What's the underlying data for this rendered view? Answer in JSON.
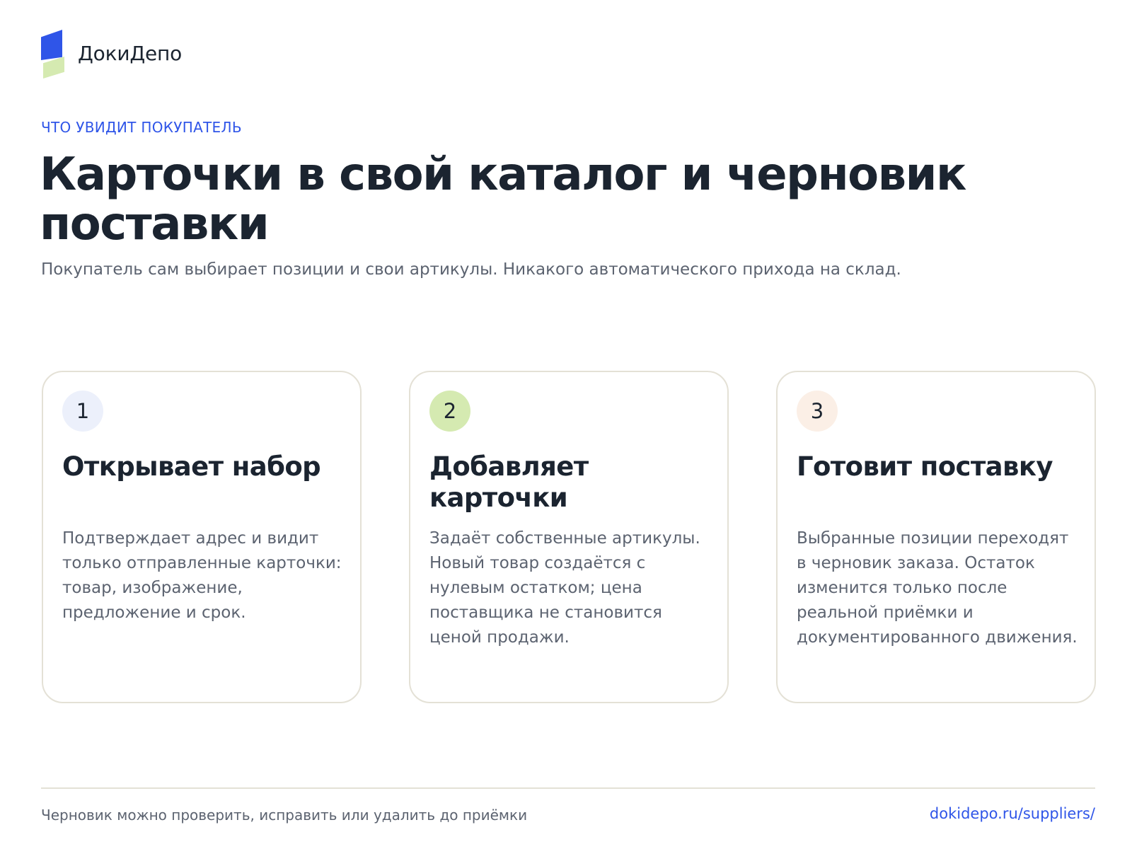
{
  "brand": {
    "name": "ДокиДепо",
    "colors": {
      "accent": "#2f55e8",
      "accent_light": "#d5eab1",
      "text": "#1b2430",
      "muted": "#5c6370",
      "border": "#e4e1d6"
    }
  },
  "header": {
    "eyebrow": "ЧТО УВИДИТ ПОКУПАТЕЛЬ",
    "title": "Карточки в свой каталог и черновик поставки",
    "subtitle": "Покупатель сам выбирает позиции и свои артикулы. Никакого автоматического прихода на склад."
  },
  "steps": [
    {
      "number": "1",
      "badge_color": "#ecf0fb",
      "title": "Открывает набор",
      "text": "Подтверждает адрес и видит только отправленные карточки: товар, изображение, предложение и срок."
    },
    {
      "number": "2",
      "badge_color": "#d5eab1",
      "title": "Добавляет карточки",
      "text": "Задаёт собственные артикулы. Новый товар создаётся с нулевым остатком; цена поставщика не становится ценой продажи."
    },
    {
      "number": "3",
      "badge_color": "#fbefe6",
      "title": "Готовит поставку",
      "text": "Выбранные позиции переходят в черновик заказа. Остаток изменится только после реальной приёмки и документированного движения."
    }
  ],
  "footer": {
    "note": "Черновик можно проверить, исправить или удалить до приёмки",
    "link": "dokidepo.ru/suppliers/"
  }
}
